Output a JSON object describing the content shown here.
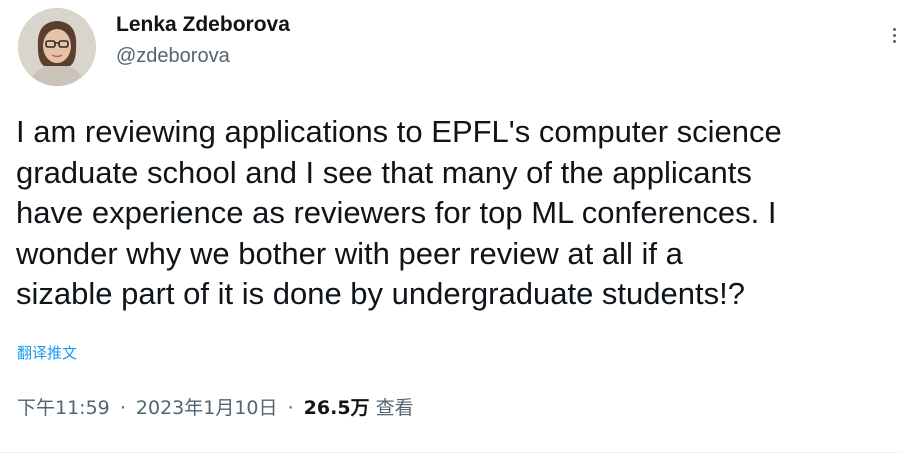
{
  "author": {
    "display_name": "Lenka Zdeborova",
    "handle": "@zdeborova",
    "avatar_icon": "profile-photo"
  },
  "tweet": {
    "lines": [
      "I am reviewing applications to EPFL's computer science",
      "graduate school and I see that many of the applicants",
      "have experience as reviewers for top ML conferences. I",
      "wonder why we bother with peer review at all if a",
      "sizable part of it is done by undergraduate students!?"
    ],
    "translate_label": "翻译推文"
  },
  "meta": {
    "time": "下午11:59",
    "separator": "·",
    "date": "2023年1月10日",
    "views_count": "26.5万",
    "views_label": "查看"
  },
  "colors": {
    "text": "#0f1419",
    "secondary": "#536471",
    "link": "#1d9bf0"
  }
}
